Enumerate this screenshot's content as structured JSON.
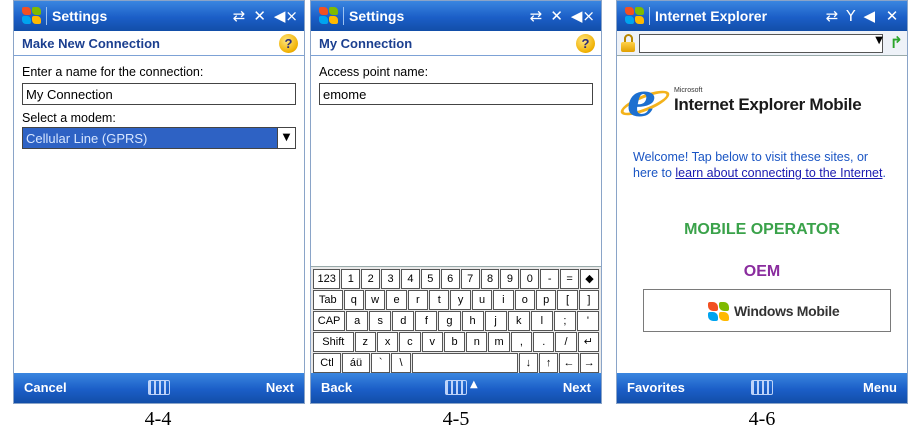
{
  "screen1": {
    "app_title": "Settings",
    "subheader": "Make New Connection",
    "name_label": "Enter a name for the connection:",
    "name_value": "My Connection",
    "modem_label": "Select a modem:",
    "modem_value": "Cellular Line (GPRS)",
    "soft_left": "Cancel",
    "soft_right": "Next",
    "caption": "4-4"
  },
  "screen2": {
    "app_title": "Settings",
    "subheader": "My Connection",
    "apn_label": "Access point name:",
    "apn_value": "emome",
    "keyboard": {
      "row1": [
        "123",
        "1",
        "2",
        "3",
        "4",
        "5",
        "6",
        "7",
        "8",
        "9",
        "0",
        "-",
        "=",
        "◆"
      ],
      "row2": [
        "Tab",
        "q",
        "w",
        "e",
        "r",
        "t",
        "y",
        "u",
        "i",
        "o",
        "p",
        "[",
        "]"
      ],
      "row3": [
        "CAP",
        "a",
        "s",
        "d",
        "f",
        "g",
        "h",
        "j",
        "k",
        "l",
        ";",
        "'"
      ],
      "row4": [
        "Shift",
        "z",
        "x",
        "c",
        "v",
        "b",
        "n",
        "m",
        ",",
        ".",
        "/",
        "↵"
      ],
      "row5": [
        "Ctl",
        "áü",
        "`",
        "\\",
        "",
        "↓",
        "↑",
        "←",
        "→"
      ]
    },
    "soft_left": "Back",
    "soft_right": "Next",
    "caption": "4-5"
  },
  "screen3": {
    "app_title": "Internet Explorer",
    "ie_vendor": "Microsoft",
    "ie_product": "Internet Explorer Mobile",
    "welcome_text": "Welcome! Tap below to visit these sites, or here to ",
    "welcome_link": "learn about connecting to the Internet",
    "welcome_end": ".",
    "operator_label": "MOBILE OPERATOR",
    "oem_label": "OEM",
    "windows_mobile": "Windows Mobile",
    "soft_left": "Favorites",
    "soft_right": "Menu",
    "caption": "4-6"
  },
  "icons": {
    "connectivity": "connectivity-icon",
    "signal": "signal-icon",
    "volume": "volume-icon",
    "help": "help-icon",
    "keyboard": "keyboard-icon",
    "lock": "lock-icon",
    "go": "go-arrow-icon",
    "close": "close-icon"
  }
}
